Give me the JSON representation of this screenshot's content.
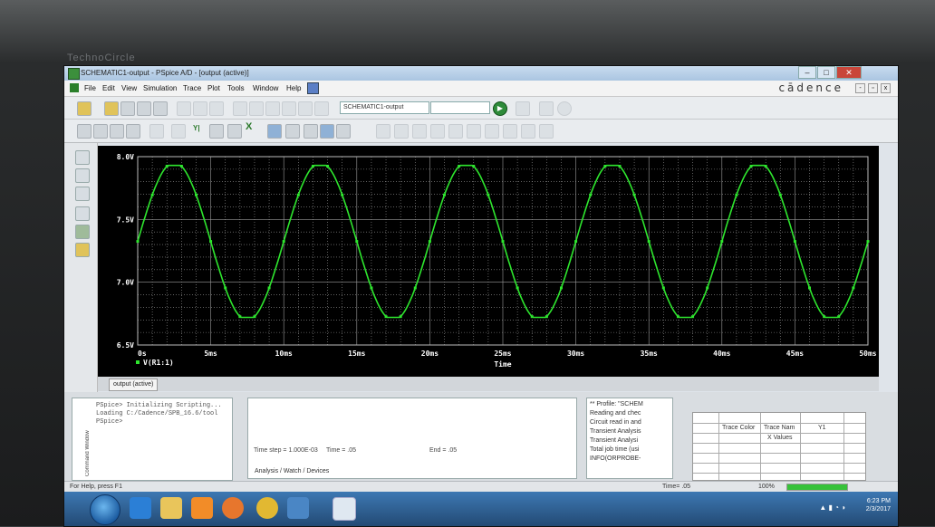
{
  "window": {
    "title": "SCHEMATIC1-output - PSpice A/D - [output (active)]",
    "brand_logo": "cādence",
    "monitor_brand": "TechnoCircle"
  },
  "menu": [
    "File",
    "Edit",
    "View",
    "Simulation",
    "Trace",
    "Plot",
    "Tools",
    "Window",
    "Help"
  ],
  "toolbar": {
    "profile_select": "SCHEMATIC1-output",
    "label_yi": "Y|",
    "label_xi": "X"
  },
  "chart_data": {
    "type": "line",
    "title": "",
    "xlabel": "Time",
    "ylabel": "",
    "xlim": [
      0,
      50
    ],
    "ylim": [
      6.5,
      8.0
    ],
    "x_ticks": [
      "0s",
      "5ms",
      "10ms",
      "15ms",
      "20ms",
      "25ms",
      "30ms",
      "35ms",
      "40ms",
      "45ms",
      "50ms"
    ],
    "y_ticks": [
      "6.5V",
      "7.0V",
      "7.5V",
      "8.0V"
    ],
    "grid": true,
    "legend": "bottom-left",
    "series": [
      {
        "name": "V(R1:1)",
        "color": "#2ee62e",
        "sine": {
          "offset": 7.325,
          "amplitude": 0.63,
          "period_ms": 10.0,
          "phase_ms": 0.0,
          "clip_high": 7.93,
          "clip_low": 6.72
        }
      }
    ]
  },
  "plot_tab": "output (active)",
  "command_window": {
    "label": "Command Window",
    "lines": [
      "PSpice> Initializing Scripting...",
      "Loading C:/Cadence/SPB_16.6/tool",
      "",
      "PSpice>"
    ]
  },
  "sim_status": {
    "time_step": "Time step = 1.000E-03",
    "time": "Time = .05",
    "end": "End = .05",
    "tabs": [
      "Analysis",
      "Watch",
      "Devices"
    ]
  },
  "output_log": [
    "** Profile: \"SCHEM",
    "Reading and chec",
    "Circuit read in and",
    "Transient Analysis",
    "Transient Analysi",
    "Total job time (usi",
    "INFO(ORPROBE-"
  ],
  "probe_table": {
    "headers": [
      "Trace Color",
      "Trace Nam",
      "Y1"
    ],
    "row2": "X Values"
  },
  "status_bar": {
    "help": "For Help, press F1",
    "time": "Time= .05",
    "zoom": "100%",
    "progress": 1.0
  },
  "taskbar": {
    "clock_time": "6:23 PM",
    "clock_date": "2/3/2017"
  },
  "colors": {
    "trace": "#2ee62e",
    "plot_bg": "#000000",
    "grid": "#9a9a9a"
  }
}
